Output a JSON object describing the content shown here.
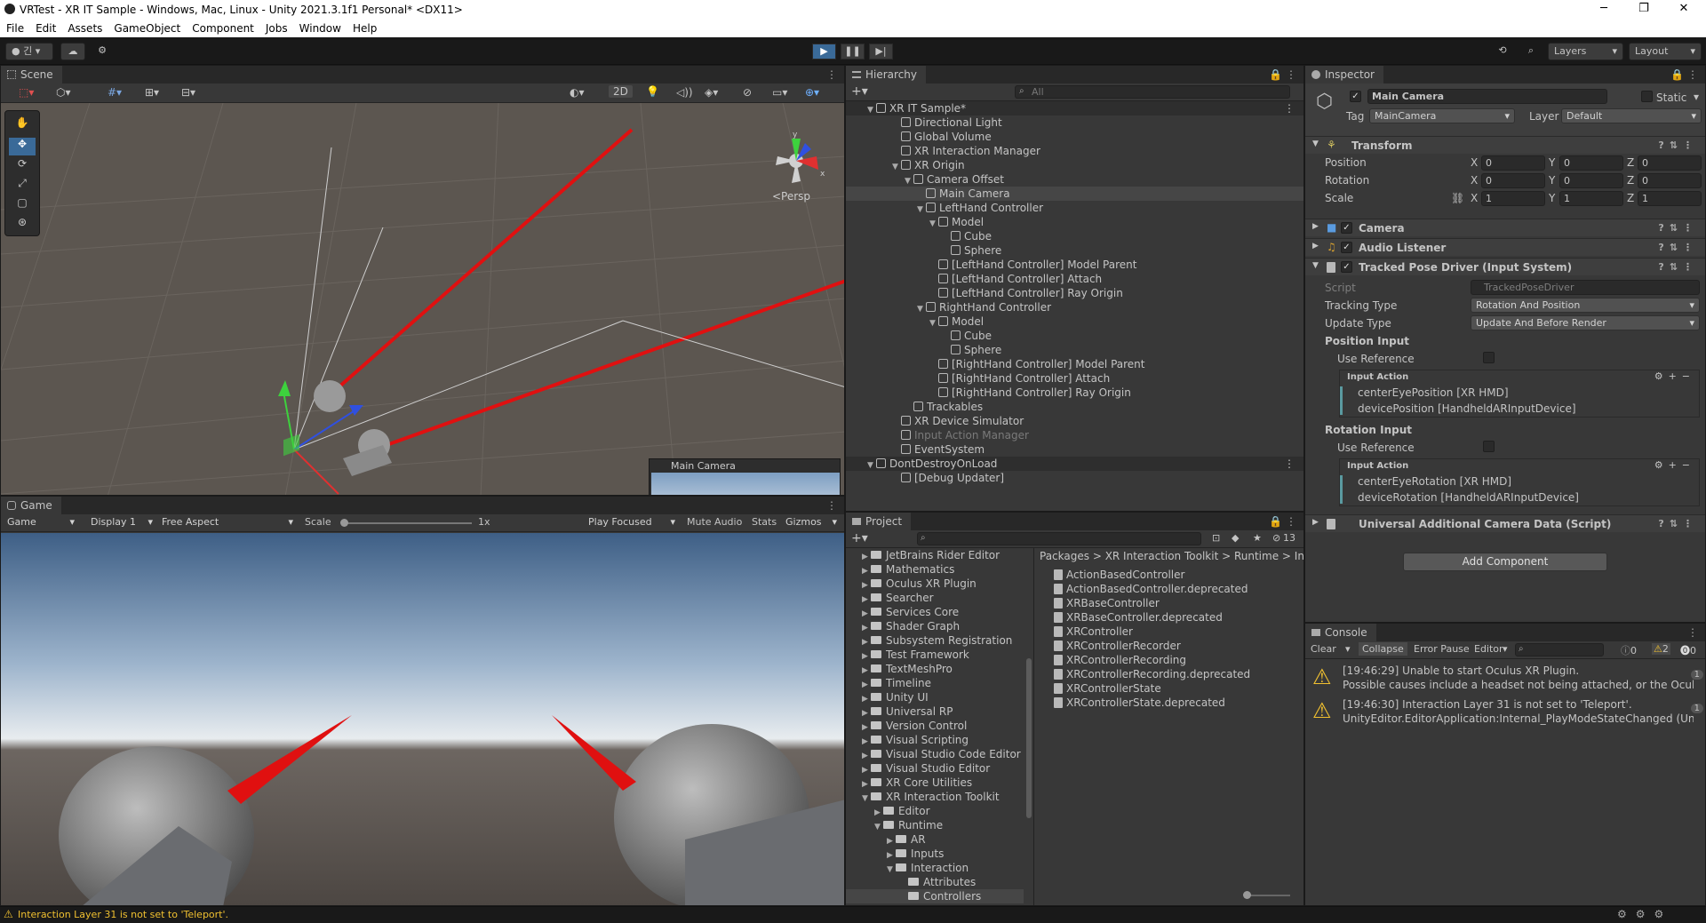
{
  "window": {
    "title": "VRTest - XR IT Sample - Windows, Mac, Linux - Unity 2021.3.1f1 Personal* <DX11>",
    "minimize": "─",
    "maximize": "❐",
    "close": "✕"
  },
  "menu": [
    "File",
    "Edit",
    "Assets",
    "GameObject",
    "Component",
    "Jobs",
    "Window",
    "Help"
  ],
  "toolbar": {
    "layers": "Layers",
    "layout": "Layout",
    "account_initial": "긴"
  },
  "scene": {
    "tab": "Scene",
    "mode_2d": "2D",
    "persp": "<Persp",
    "cam_preview_title": "Main Camera"
  },
  "game": {
    "tab": "Game",
    "display_mode": "Game",
    "display": "Display 1",
    "aspect": "Free Aspect",
    "scale_label": "Scale",
    "scale_value": "1x",
    "play_focused": "Play Focused",
    "mute": "Mute Audio",
    "stats": "Stats",
    "gizmos": "Gizmos"
  },
  "hierarchy": {
    "tab": "Hierarchy",
    "search_placeholder": "All",
    "items": [
      {
        "label": "XR IT Sample*",
        "depth": 0,
        "arrow": "▼",
        "scene": true
      },
      {
        "label": "Directional Light",
        "depth": 2
      },
      {
        "label": "Global Volume",
        "depth": 2
      },
      {
        "label": "XR Interaction Manager",
        "depth": 2
      },
      {
        "label": "XR Origin",
        "depth": 2,
        "arrow": "▼"
      },
      {
        "label": "Camera Offset",
        "depth": 3,
        "arrow": "▼"
      },
      {
        "label": "Main Camera",
        "depth": 4,
        "selected": true
      },
      {
        "label": "LeftHand Controller",
        "depth": 4,
        "arrow": "▼"
      },
      {
        "label": "Model",
        "depth": 5,
        "arrow": "▼"
      },
      {
        "label": "Cube",
        "depth": 6
      },
      {
        "label": "Sphere",
        "depth": 6
      },
      {
        "label": "[LeftHand Controller] Model Parent",
        "depth": 5
      },
      {
        "label": "[LeftHand Controller] Attach",
        "depth": 5
      },
      {
        "label": "[LeftHand Controller] Ray Origin",
        "depth": 5
      },
      {
        "label": "RightHand Controller",
        "depth": 4,
        "arrow": "▼"
      },
      {
        "label": "Model",
        "depth": 5,
        "arrow": "▼"
      },
      {
        "label": "Cube",
        "depth": 6
      },
      {
        "label": "Sphere",
        "depth": 6
      },
      {
        "label": "[RightHand Controller] Model Parent",
        "depth": 5
      },
      {
        "label": "[RightHand Controller] Attach",
        "depth": 5
      },
      {
        "label": "[RightHand Controller] Ray Origin",
        "depth": 5
      },
      {
        "label": "Trackables",
        "depth": 3
      },
      {
        "label": "XR Device Simulator",
        "depth": 2
      },
      {
        "label": "Input Action Manager",
        "depth": 2,
        "disabled": true
      },
      {
        "label": "EventSystem",
        "depth": 2
      },
      {
        "label": "DontDestroyOnLoad",
        "depth": 0,
        "arrow": "▼",
        "scene": true
      },
      {
        "label": "[Debug Updater]",
        "depth": 2
      }
    ]
  },
  "project": {
    "tab": "Project",
    "count": "13",
    "folders": [
      {
        "label": "JetBrains Rider Editor",
        "depth": 0,
        "arrow": "▶"
      },
      {
        "label": "Mathematics",
        "depth": 0,
        "arrow": "▶"
      },
      {
        "label": "Oculus XR Plugin",
        "depth": 0,
        "arrow": "▶"
      },
      {
        "label": "Searcher",
        "depth": 0,
        "arrow": "▶"
      },
      {
        "label": "Services Core",
        "depth": 0,
        "arrow": "▶"
      },
      {
        "label": "Shader Graph",
        "depth": 0,
        "arrow": "▶"
      },
      {
        "label": "Subsystem Registration",
        "depth": 0,
        "arrow": "▶"
      },
      {
        "label": "Test Framework",
        "depth": 0,
        "arrow": "▶"
      },
      {
        "label": "TextMeshPro",
        "depth": 0,
        "arrow": "▶"
      },
      {
        "label": "Timeline",
        "depth": 0,
        "arrow": "▶"
      },
      {
        "label": "Unity UI",
        "depth": 0,
        "arrow": "▶"
      },
      {
        "label": "Universal RP",
        "depth": 0,
        "arrow": "▶"
      },
      {
        "label": "Version Control",
        "depth": 0,
        "arrow": "▶"
      },
      {
        "label": "Visual Scripting",
        "depth": 0,
        "arrow": "▶"
      },
      {
        "label": "Visual Studio Code Editor",
        "depth": 0,
        "arrow": "▶"
      },
      {
        "label": "Visual Studio Editor",
        "depth": 0,
        "arrow": "▶"
      },
      {
        "label": "XR Core Utilities",
        "depth": 0,
        "arrow": "▶"
      },
      {
        "label": "XR Interaction Toolkit",
        "depth": 0,
        "arrow": "▼"
      },
      {
        "label": "Editor",
        "depth": 1,
        "arrow": "▶"
      },
      {
        "label": "Runtime",
        "depth": 1,
        "arrow": "▼"
      },
      {
        "label": "AR",
        "depth": 2,
        "arrow": "▶"
      },
      {
        "label": "Inputs",
        "depth": 2,
        "arrow": "▶"
      },
      {
        "label": "Interaction",
        "depth": 2,
        "arrow": "▼"
      },
      {
        "label": "Attributes",
        "depth": 3,
        "arrow": ""
      },
      {
        "label": "Controllers",
        "depth": 3,
        "arrow": "",
        "selected": true
      }
    ],
    "breadcrumb": [
      "Packages",
      "XR Interaction Toolkit",
      "Runtime",
      "Inte"
    ],
    "files": [
      "ActionBasedController",
      "ActionBasedController.deprecated",
      "XRBaseController",
      "XRBaseController.deprecated",
      "XRController",
      "XRControllerRecorder",
      "XRControllerRecording",
      "XRControllerRecording.deprecated",
      "XRControllerState",
      "XRControllerState.deprecated"
    ]
  },
  "inspector": {
    "tab": "Inspector",
    "object_name": "Main Camera",
    "static": "Static",
    "tag_label": "Tag",
    "tag": "MainCamera",
    "layer_label": "Layer",
    "layer": "Default",
    "transform": {
      "title": "Transform",
      "rows": [
        {
          "label": "Position",
          "x": "0",
          "y": "0",
          "z": "0"
        },
        {
          "label": "Rotation",
          "x": "0",
          "y": "0",
          "z": "0"
        },
        {
          "label": "Scale",
          "x": "1",
          "y": "1",
          "z": "1"
        }
      ]
    },
    "camera": "Camera",
    "audio": "Audio Listener",
    "tpd": {
      "title": "Tracked Pose Driver (Input System)",
      "script_label": "Script",
      "script": "TrackedPoseDriver",
      "tracking_label": "Tracking Type",
      "tracking": "Rotation And Position",
      "update_label": "Update Type",
      "update": "Update And Before Render",
      "pos_input": "Position Input",
      "use_ref": "Use Reference",
      "input_action": "Input Action",
      "pos_bindings": [
        "centerEyePosition [XR HMD]",
        "devicePosition [HandheldARInputDevice]"
      ],
      "rot_input": "Rotation Input",
      "rot_bindings": [
        "centerEyeRotation [XR HMD]",
        "deviceRotation [HandheldARInputDevice]"
      ]
    },
    "uacd": "Universal Additional Camera Data (Script)",
    "add_component": "Add Component"
  },
  "console": {
    "tab": "Console",
    "clear": "Clear",
    "collapse": "Collapse",
    "error_pause": "Error Pause",
    "editor": "Editor",
    "count_info": "0",
    "count_warn": "2",
    "count_err": "0",
    "messages": [
      {
        "line1": "[19:46:29] Unable to start Oculus XR Plugin.",
        "line2": "Possible causes include a headset not being attached, or the Oculus runti",
        "badge": "1"
      },
      {
        "line1": "[19:46:30] Interaction Layer 31 is not set to 'Teleport'.",
        "line2": "UnityEditor.EditorApplication:Internal_PlayModeStateChanged (UnityEdit",
        "badge": "1"
      }
    ]
  },
  "status": {
    "message": "Interaction Layer 31 is not set to 'Teleport'."
  },
  "colors": {
    "accent": "#2c5d87",
    "warn": "#f0c030",
    "ray": "#e01010"
  }
}
